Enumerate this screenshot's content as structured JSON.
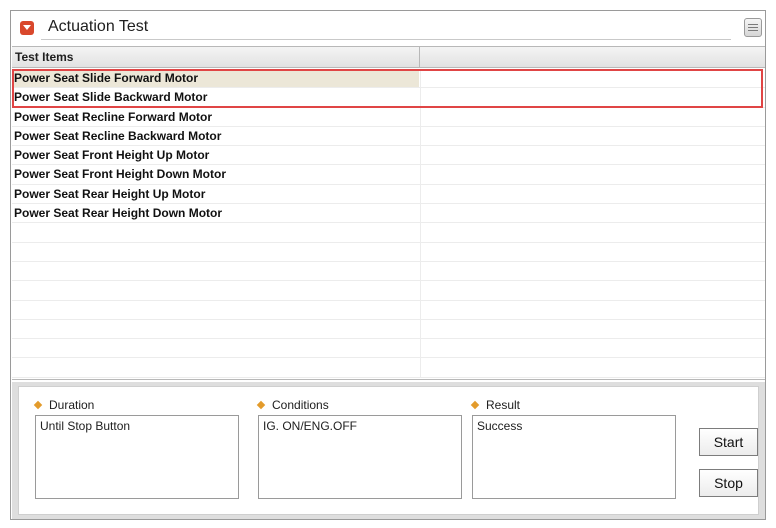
{
  "window": {
    "title": "Actuation Test"
  },
  "grid": {
    "columns": [
      "Test Items",
      ""
    ],
    "items": [
      "Power Seat Slide Forward Motor",
      "Power Seat Slide Backward Motor",
      "Power Seat Recline Forward Motor",
      "Power Seat Recline Backward Motor",
      "Power Seat Front Height Up Motor",
      "Power Seat Front Height Down Motor",
      "Power Seat Rear Height Up Motor",
      "Power Seat Rear Height Down Motor"
    ],
    "selected_index": 0,
    "highlighted_items": [
      0,
      1
    ],
    "empty_rows": 8
  },
  "panel": {
    "duration": {
      "label": "Duration",
      "value": "Until Stop Button"
    },
    "conditions": {
      "label": "Conditions",
      "value": "IG. ON/ENG.OFF"
    },
    "result": {
      "label": "Result",
      "value": "Success"
    },
    "start_label": "Start",
    "stop_label": "Stop"
  },
  "colors": {
    "accent": "#d9482c",
    "highlight_border": "#e04545",
    "selected_row": "#ece7d8",
    "bullet": "#e39b2b"
  },
  "icons": {
    "title": "dropdown-arrow-icon",
    "menu": "menu-icon",
    "bullet": "diamond-bullet-icon"
  }
}
